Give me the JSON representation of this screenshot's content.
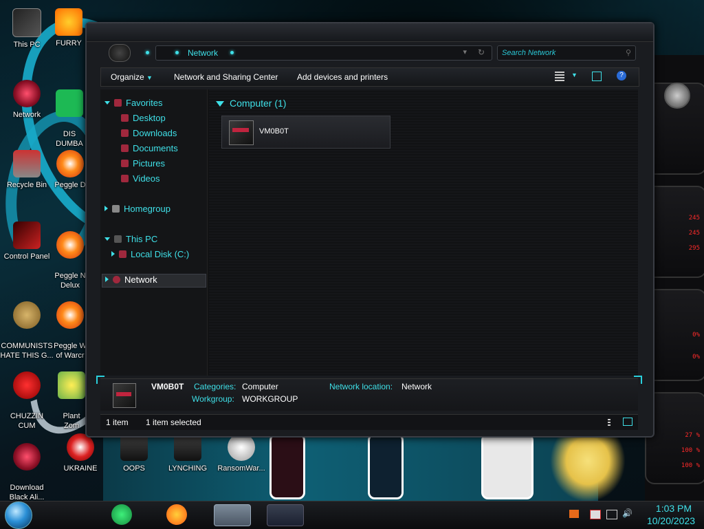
{
  "desktop": {
    "icons": [
      {
        "label": "This PC"
      },
      {
        "label": "FURRY"
      },
      {
        "label": "Network"
      },
      {
        "label": "DIS\nDUMBA"
      },
      {
        "label": "Recycle Bin"
      },
      {
        "label": "Peggle D"
      },
      {
        "label": "Control Panel"
      },
      {
        "label": "Peggle N\nDelux"
      },
      {
        "label": "COMMUNISTS\nHATE THIS G..."
      },
      {
        "label": "Peggle W\nof Warcr"
      },
      {
        "label": "CHUZZIN\nCUM"
      },
      {
        "label": "Plant\nZom"
      },
      {
        "label": "Download\nBlack Ali..."
      },
      {
        "label": "UKRAINE"
      },
      {
        "label": "OOPS"
      },
      {
        "label": "LYNCHING"
      },
      {
        "label": "RansomWar..."
      }
    ]
  },
  "hud": {
    "values": [
      "245",
      "245",
      "295",
      "0%",
      "0%",
      "27 %",
      "100 %",
      "100 %"
    ]
  },
  "explorer": {
    "address": "Network",
    "search_placeholder": "Search Network",
    "toolbar": {
      "organize": "Organize",
      "network_sharing": "Network and Sharing Center",
      "add_devices": "Add devices and printers"
    },
    "nav": {
      "favorites": "Favorites",
      "desktop": "Desktop",
      "downloads": "Downloads",
      "documents": "Documents",
      "pictures": "Pictures",
      "videos": "Videos",
      "homegroup": "Homegroup",
      "this_pc": "This PC",
      "local_disk": "Local Disk (C:)",
      "network": "Network"
    },
    "group_header": "Computer (1)",
    "computer_name": "VM0B0T",
    "details": {
      "name": "VM0B0T",
      "categories_label": "Categories:",
      "categories_value": "Computer",
      "workgroup_label": "Workgroup:",
      "workgroup_value": "WORKGROUP",
      "location_label": "Network location:",
      "location_value": "Network"
    },
    "status": {
      "count": "1 item",
      "selected": "1 item selected"
    }
  },
  "taskbar": {
    "time": "1:03 PM",
    "date": "10/20/2023"
  },
  "colors": {
    "accent_cyan": "#3fe0e8",
    "accent_red": "#c0243e",
    "window_bg": "#1a1c20"
  }
}
